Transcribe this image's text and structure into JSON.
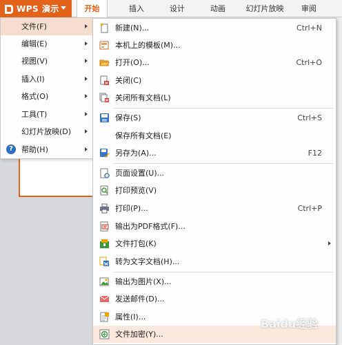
{
  "app": {
    "title": "WPS 演示"
  },
  "tabs": [
    {
      "label": "开始",
      "active": true
    },
    {
      "label": "插入"
    },
    {
      "label": "设计"
    },
    {
      "label": "动画"
    },
    {
      "label": "幻灯片放映"
    },
    {
      "label": "审阅"
    }
  ],
  "left_menu": [
    {
      "label": "文件(F)",
      "icon": "",
      "has_submenu": true,
      "active": true
    },
    {
      "label": "编辑(E)",
      "icon": "",
      "has_submenu": true
    },
    {
      "label": "视图(V)",
      "icon": "",
      "has_submenu": true
    },
    {
      "label": "插入(I)",
      "icon": "",
      "has_submenu": true
    },
    {
      "label": "格式(O)",
      "icon": "",
      "has_submenu": true
    },
    {
      "label": "工具(T)",
      "icon": "",
      "has_submenu": true
    },
    {
      "label": "幻灯片放映(D)",
      "icon": "",
      "has_submenu": true
    },
    {
      "label": "帮助(H)",
      "icon": "help-icon",
      "has_submenu": true
    }
  ],
  "file_menu": [
    {
      "label": "新建(N)...",
      "shortcut": "Ctrl+N",
      "icon": "new-doc-icon"
    },
    {
      "label": "本机上的模板(M)...",
      "shortcut": "",
      "icon": "template-icon"
    },
    {
      "label": "打开(O)...",
      "shortcut": "Ctrl+O",
      "icon": "open-folder-icon"
    },
    {
      "label": "关闭(C)",
      "shortcut": "",
      "icon": "close-doc-icon"
    },
    {
      "label": "关闭所有文档(L)",
      "shortcut": "",
      "icon": "close-all-icon"
    },
    {
      "label": "保存(S)",
      "shortcut": "Ctrl+S",
      "icon": "save-icon"
    },
    {
      "label": "保存所有文档(E)",
      "shortcut": "",
      "icon": ""
    },
    {
      "label": "另存为(A)...",
      "shortcut": "F12",
      "icon": "save-as-icon"
    },
    {
      "label": "页面设置(U)...",
      "shortcut": "",
      "icon": "page-setup-icon"
    },
    {
      "label": "打印预览(V)",
      "shortcut": "",
      "icon": "print-preview-icon"
    },
    {
      "label": "打印(P)...",
      "shortcut": "Ctrl+P",
      "icon": "print-icon"
    },
    {
      "label": "输出为PDF格式(F)...",
      "shortcut": "",
      "icon": "pdf-icon"
    },
    {
      "label": "文件打包(K)",
      "shortcut": "",
      "icon": "package-icon",
      "has_submenu": true
    },
    {
      "label": "转为文字文档(H)...",
      "shortcut": "",
      "icon": "to-word-icon"
    },
    {
      "label": "输出为图片(X)...",
      "shortcut": "",
      "icon": "export-image-icon"
    },
    {
      "label": "发送邮件(D)...",
      "shortcut": "",
      "icon": "mail-icon"
    },
    {
      "label": "属性(I)...",
      "shortcut": "",
      "icon": "properties-icon"
    },
    {
      "label": "文件加密(Y)...",
      "shortcut": "",
      "icon": "encrypt-icon",
      "highlighted": true
    }
  ],
  "watermark": "Baidu经验",
  "colors": {
    "accent": "#e2621b",
    "menu_active": "#f5ddd0",
    "menu_highlight": "#f9e8de"
  }
}
